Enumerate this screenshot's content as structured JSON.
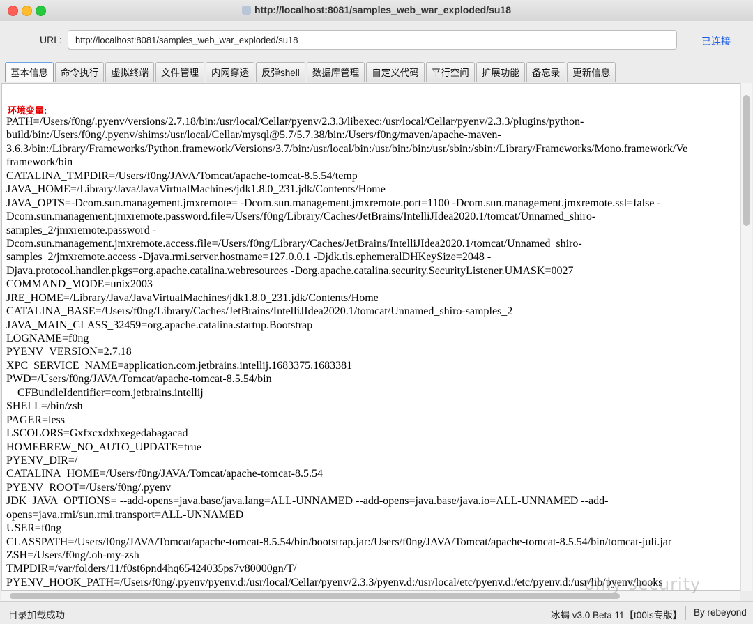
{
  "window": {
    "title": "http://localhost:8081/samples_web_war_exploded/su18"
  },
  "urlbar": {
    "label": "URL:",
    "value": "http://localhost:8081/samples_web_war_exploded/su18",
    "status": "已连接"
  },
  "tabs": [
    "基本信息",
    "命令执行",
    "虚拟终端",
    "文件管理",
    "内网穿透",
    "反弹shell",
    "数据库管理",
    "自定义代码",
    "平行空间",
    "扩展功能",
    "备忘录",
    "更新信息"
  ],
  "content": {
    "label": "环境变量:",
    "lines": [
      "PATH=/Users/f0ng/.pyenv/versions/2.7.18/bin:/usr/local/Cellar/pyenv/2.3.3/libexec:/usr/local/Cellar/pyenv/2.3.3/plugins/python-",
      "build/bin:/Users/f0ng/.pyenv/shims:/usr/local/Cellar/mysql@5.7/5.7.38/bin:/Users/f0ng/maven/apache-maven-",
      "3.6.3/bin:/Library/Frameworks/Python.framework/Versions/3.7/bin:/usr/local/bin:/usr/bin:/bin:/usr/sbin:/sbin:/Library/Frameworks/Mono.framework/Ve",
      "framework/bin",
      "CATALINA_TMPDIR=/Users/f0ng/JAVA/Tomcat/apache-tomcat-8.5.54/temp",
      "JAVA_HOME=/Library/Java/JavaVirtualMachines/jdk1.8.0_231.jdk/Contents/Home",
      "JAVA_OPTS=-Dcom.sun.management.jmxremote= -Dcom.sun.management.jmxremote.port=1100 -Dcom.sun.management.jmxremote.ssl=false -",
      "Dcom.sun.management.jmxremote.password.file=/Users/f0ng/Library/Caches/JetBrains/IntelliJIdea2020.1/tomcat/Unnamed_shiro-",
      "samples_2/jmxremote.password -",
      "Dcom.sun.management.jmxremote.access.file=/Users/f0ng/Library/Caches/JetBrains/IntelliJIdea2020.1/tomcat/Unnamed_shiro-",
      "samples_2/jmxremote.access -Djava.rmi.server.hostname=127.0.0.1 -Djdk.tls.ephemeralDHKeySize=2048 -",
      "Djava.protocol.handler.pkgs=org.apache.catalina.webresources -Dorg.apache.catalina.security.SecurityListener.UMASK=0027",
      "COMMAND_MODE=unix2003",
      "JRE_HOME=/Library/Java/JavaVirtualMachines/jdk1.8.0_231.jdk/Contents/Home",
      "CATALINA_BASE=/Users/f0ng/Library/Caches/JetBrains/IntelliJIdea2020.1/tomcat/Unnamed_shiro-samples_2",
      "JAVA_MAIN_CLASS_32459=org.apache.catalina.startup.Bootstrap",
      "LOGNAME=f0ng",
      "PYENV_VERSION=2.7.18",
      "XPC_SERVICE_NAME=application.com.jetbrains.intellij.1683375.1683381",
      "PWD=/Users/f0ng/JAVA/Tomcat/apache-tomcat-8.5.54/bin",
      "__CFBundleIdentifier=com.jetbrains.intellij",
      "SHELL=/bin/zsh",
      "PAGER=less",
      "LSCOLORS=Gxfxcxdxbxegedabagacad",
      "HOMEBREW_NO_AUTO_UPDATE=true",
      "PYENV_DIR=/",
      "CATALINA_HOME=/Users/f0ng/JAVA/Tomcat/apache-tomcat-8.5.54",
      "PYENV_ROOT=/Users/f0ng/.pyenv",
      "JDK_JAVA_OPTIONS= --add-opens=java.base/java.lang=ALL-UNNAMED --add-opens=java.base/java.io=ALL-UNNAMED --add-",
      "opens=java.rmi/sun.rmi.transport=ALL-UNNAMED",
      "USER=f0ng",
      "CLASSPATH=/Users/f0ng/JAVA/Tomcat/apache-tomcat-8.5.54/bin/bootstrap.jar:/Users/f0ng/JAVA/Tomcat/apache-tomcat-8.5.54/bin/tomcat-juli.jar",
      "ZSH=/Users/f0ng/.oh-my-zsh",
      "TMPDIR=/var/folders/11/f0st6pnd4hq65424035ps7v80000gn/T/",
      "PYENV_HOOK_PATH=/Users/f0ng/.pyenv/pyenv.d:/usr/local/Cellar/pyenv/2.3.3/pyenv.d:/usr/local/etc/pyenv.d:/etc/pyenv.d:/usr/lib/pyenv/hooks"
    ]
  },
  "status": {
    "left": "目录加载成功",
    "version": "冰蝎 v3.0 Beta 11【t00ls专版】",
    "by": "By rebeyond"
  },
  "watermark": "only security"
}
